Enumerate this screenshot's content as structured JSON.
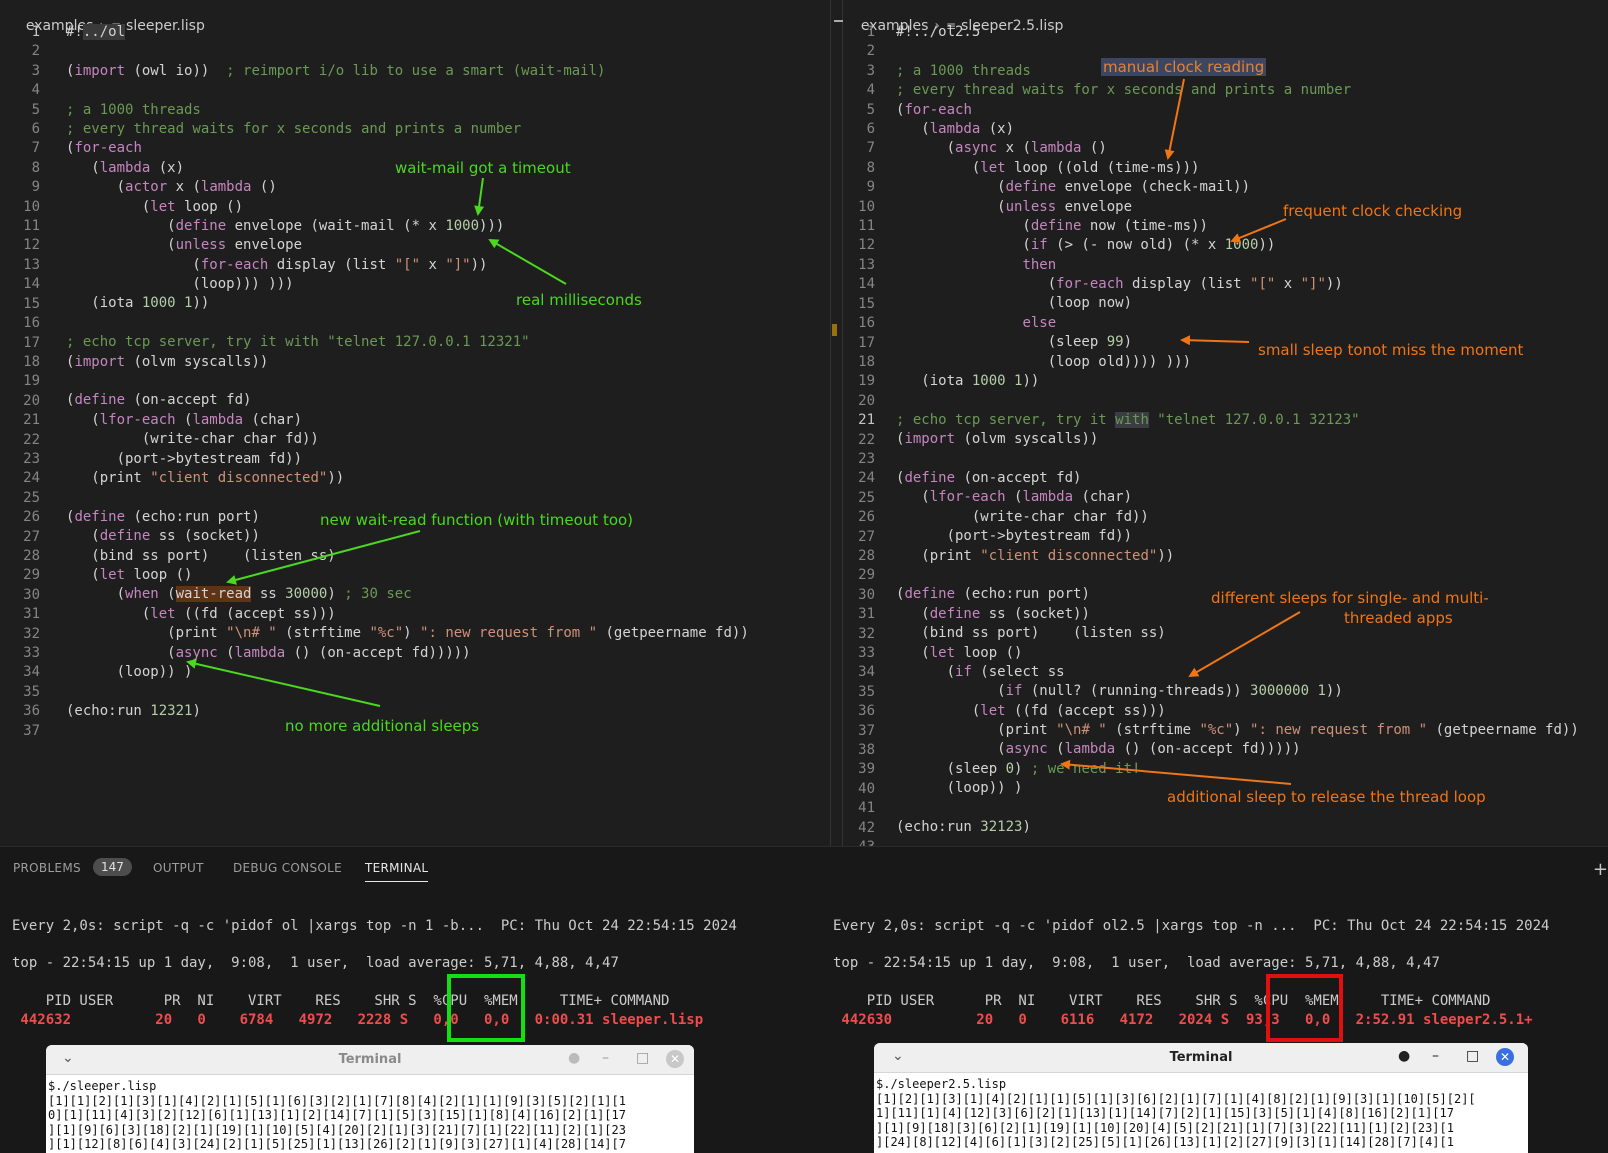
{
  "left": {
    "breadcrumb_root": "examples",
    "breadcrumb_file": "sleeper.lisp",
    "lines": [
      "#!../ol",
      "",
      "(import (owl io))  ; reimport i/o lib to use a smart (wait-mail)",
      "",
      "; a 1000 threads",
      "; every thread waits for x seconds and prints a number",
      "(for-each",
      "   (lambda (x)",
      "      (actor x (lambda ()",
      "         (let loop ()",
      "            (define envelope (wait-mail (* x 1000)))",
      "            (unless envelope",
      "               (for-each display (list \"[\" x \"]\"))",
      "               (loop))) )))",
      "   (iota 1000 1))",
      "",
      "; echo tcp server, try it with \"telnet 127.0.0.1 12321\"",
      "(import (olvm syscalls))",
      "",
      "(define (on-accept fd)",
      "   (lfor-each (lambda (char)",
      "         (write-char char fd))",
      "      (port->bytestream fd))",
      "   (print \"client disconnected\"))",
      "",
      "(define (echo:run port)",
      "   (define ss (socket))",
      "   (bind ss port)    (listen ss)",
      "   (let loop ()",
      "      (when (wait-read ss 30000) ; 30 sec",
      "         (let ((fd (accept ss)))",
      "            (print \"\\n# \" (strftime \"%c\") \": new request from \" (getpeername fd))",
      "            (async (lambda () (on-accept fd)))))",
      "      (loop)) )",
      "",
      "(echo:run 12321)",
      ""
    ],
    "annotations": {
      "wait_mail": "wait-mail got a timeout",
      "real_ms": "real milliseconds",
      "wait_read": "new wait-read function (with timeout too)",
      "no_sleeps": "no more additional sleeps"
    }
  },
  "right": {
    "breadcrumb_root": "examples",
    "breadcrumb_file": "sleeper2.5.lisp",
    "lines": [
      "#!../ol2.5",
      "",
      "; a 1000 threads",
      "; every thread waits for x seconds and prints a number",
      "(for-each",
      "   (lambda (x)",
      "      (async x (lambda ()",
      "         (let loop ((old (time-ms)))",
      "            (define envelope (check-mail))",
      "            (unless envelope",
      "               (define now (time-ms))",
      "               (if (> (- now old) (* x 1000))",
      "               then",
      "                  (for-each display (list \"[\" x \"]\"))",
      "                  (loop now)",
      "               else",
      "                  (sleep 99)",
      "                  (loop old)))) )))",
      "   (iota 1000 1))",
      "",
      "; echo tcp server, try it with \"telnet 127.0.0.1 32123\"",
      "(import (olvm syscalls))",
      "",
      "(define (on-accept fd)",
      "   (lfor-each (lambda (char)",
      "         (write-char char fd))",
      "      (port->bytestream fd))",
      "   (print \"client disconnected\"))",
      "",
      "(define (echo:run port)",
      "   (define ss (socket))",
      "   (bind ss port)    (listen ss)",
      "   (let loop ()",
      "      (if (select ss",
      "            (if (null? (running-threads)) 3000000 1))",
      "         (let ((fd (accept ss)))",
      "            (print \"\\n# \" (strftime \"%c\") \": new request from \" (getpeername fd))",
      "            (async (lambda () (on-accept fd)))))",
      "      (sleep 0) ; we need it!",
      "      (loop)) )",
      "",
      "(echo:run 32123)",
      ""
    ],
    "annotations": {
      "manual_clock": "manual clock reading",
      "frequent_clock": "frequent clock checking",
      "small_sleep": "small sleep tonot miss the moment",
      "diff_sleeps_1": "different sleeps for single- and multi-",
      "diff_sleeps_2": "threaded apps",
      "additional_sleep": "additional sleep to release the thread loop"
    }
  },
  "panel": {
    "tabs": [
      "PROBLEMS",
      "OUTPUT",
      "DEBUG CONSOLE",
      "TERMINAL"
    ],
    "problems_count": "147",
    "plus": "+"
  },
  "term_left": {
    "l1": "Every 2,0s: script -q -c 'pidof ol |xargs top -n 1 -b...  PC: Thu Oct 24 22:54:15 2024",
    "l2": "top - 22:54:15 up 1 day,  9:08,  1 user,  load average: 5,71, 4,88, 4,47",
    "header": "    PID USER      PR  NI    VIRT    RES    SHR S  %CPU  %MEM     TIME+ COMMAND",
    "row": " 442632          20   0    6784   4972   2228 S   0,0   0,0   0:00.31 sleeper.lisp"
  },
  "term_right": {
    "l1": "Every 2,0s: script -q -c 'pidof ol2.5 |xargs top -n ...  PC: Thu Oct 24 22:54:15 2024",
    "l2": "top - 22:54:15 up 1 day,  9:08,  1 user,  load average: 5,71, 4,88, 4,47",
    "header": "    PID USER      PR  NI    VIRT    RES    SHR S  %CPU  %MEM     TIME+ COMMAND",
    "row": " 442630          20   0    6116   4172   2024 S  93,3   0,0   2:52.91 sleeper2.5.1+"
  },
  "win_left": {
    "title": "Terminal",
    "body": "$./sleeper.lisp\n[1][1][2][1][3][1][4][2][1][5][1][6][3][2][1][7][8][4][2][1][1][9][3][5][2][1][1\n0][1][11][4][3][2][12][6][1][13][1][2][14][7][1][5][3][15][1][8][4][16][2][1][17\n][1][9][6][3][18][2][1][19][1][10][5][4][20][2][1][3][21][7][1][22][11][2][1][23\n][1][12][8][6][4][3][24][2][1][5][25][1][13][26][2][1][9][3][27][1][4][28][14][7"
  },
  "win_right": {
    "title": "Terminal",
    "body": "$./sleeper2.5.lisp\n[1][2][1][3][1][4][2][1][1][5][1][3][6][2][1][7][1][4][8][2][1][9][3][1][10][5][2][\n1][11][1][4][12][3][6][2][1][13][1][14][7][2][1][15][3][5][1][4][8][16][2][1][17\n][1][9][18][3][6][2][1][19][1][10][20][4][5][2][21][1][7][3][22][11][1][2][23][1\n][24][8][12][4][6][1][3][2][25][5][1][26][13][1][2][27][9][3][1][14][28][7][4][1"
  },
  "colors": {
    "green_annotation": "#4bd81e",
    "orange_annotation": "#f07515",
    "cpu_box_ok": "#11e011",
    "cpu_box_bad": "#e01010",
    "process_row": "#f14c4c"
  }
}
